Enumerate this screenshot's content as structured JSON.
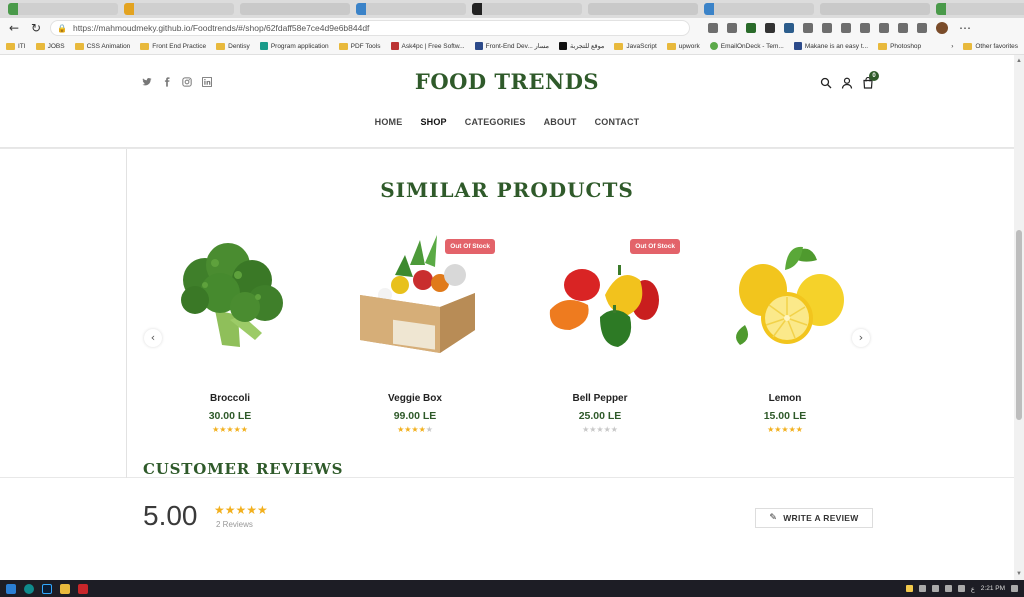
{
  "browser": {
    "url": "https://mahmoudmeky.github.io/Foodtrends/#/shop/62fdaff58e7ce4d9e6b844df",
    "bookmarks": [
      {
        "label": "ITI",
        "kind": "folder"
      },
      {
        "label": "JOBS",
        "kind": "folder"
      },
      {
        "label": "CSS Animation",
        "kind": "folder"
      },
      {
        "label": "Front End Practice",
        "kind": "folder"
      },
      {
        "label": "Dentisy",
        "kind": "folder"
      },
      {
        "label": "Program application",
        "kind": "teal"
      },
      {
        "label": "PDF Tools",
        "kind": "folder"
      },
      {
        "label": "Ask4pc | Free Softw...",
        "kind": "red"
      },
      {
        "label": "Front-End Dev... مسار",
        "kind": "navy"
      },
      {
        "label": "موقع للتجربة",
        "kind": "black"
      },
      {
        "label": "JavaScript",
        "kind": "folder"
      },
      {
        "label": "upwork",
        "kind": "folder"
      },
      {
        "label": "EmailOnDeck - Tem...",
        "kind": "green"
      },
      {
        "label": "Makane is an easy t...",
        "kind": "navy"
      },
      {
        "label": "Photoshop",
        "kind": "folder"
      }
    ],
    "other_favorites": "Other favorites"
  },
  "site": {
    "logo": "FOOD TRENDS",
    "cart_count": "0",
    "nav": [
      {
        "label": "HOME",
        "active": false
      },
      {
        "label": "SHOP",
        "active": true
      },
      {
        "label": "CATEGORIES",
        "active": false
      },
      {
        "label": "ABOUT",
        "active": false
      },
      {
        "label": "CONTACT",
        "active": false
      }
    ]
  },
  "similar": {
    "title": "SIMILAR PRODUCTS",
    "products": [
      {
        "name": "Broccoli",
        "price": "30.00 LE",
        "rating": 5,
        "badge": ""
      },
      {
        "name": "Veggie Box",
        "price": "99.00 LE",
        "rating": 4,
        "badge": "Out Of Stock"
      },
      {
        "name": "Bell Pepper",
        "price": "25.00 LE",
        "rating": 0,
        "badge": "Out Of Stock"
      },
      {
        "name": "Lemon",
        "price": "15.00 LE",
        "rating": 5,
        "badge": ""
      }
    ]
  },
  "reviews": {
    "title": "CUSTOMER REVIEWS",
    "average": "5.00",
    "count_text": "2 Reviews",
    "write_label": "WRITE A REVIEW"
  },
  "taskbar": {
    "lang": "ع",
    "time": "2:21 PM"
  },
  "colors": {
    "brand_green": "#2f5a2a",
    "star": "#f2b01e",
    "badge_red": "#e3636a"
  }
}
